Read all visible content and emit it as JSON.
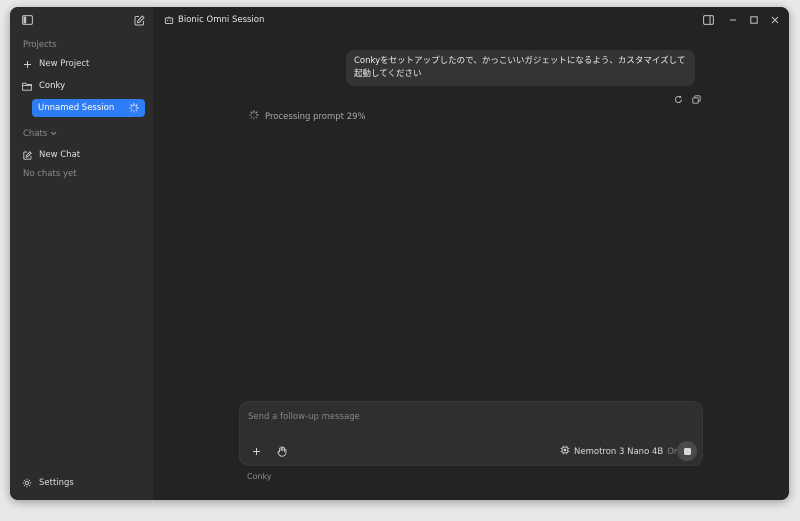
{
  "sidebar": {
    "projects_label": "Projects",
    "new_project_label": "New Project",
    "project_name": "Conky",
    "active_session": "Unnamed Session",
    "chats_label": "Chats",
    "new_chat_label": "New Chat",
    "no_chats": "No chats yet",
    "settings_label": "Settings"
  },
  "header": {
    "title": "Bionic Omni Session"
  },
  "chat": {
    "user_message": "Conkyをセットアップしたので、かっこいいガジェットになるよう、カスタマイズして起動してください",
    "processing_text": "Processing prompt 29%"
  },
  "composer": {
    "placeholder": "Send a follow-up message",
    "model_name": "Nemotron 3 Nano 4B",
    "model_state": "On",
    "project_tag": "Conky"
  },
  "colors": {
    "accent": "#2f7df6",
    "background": "#232323",
    "sidebar": "#2c2c2c"
  }
}
